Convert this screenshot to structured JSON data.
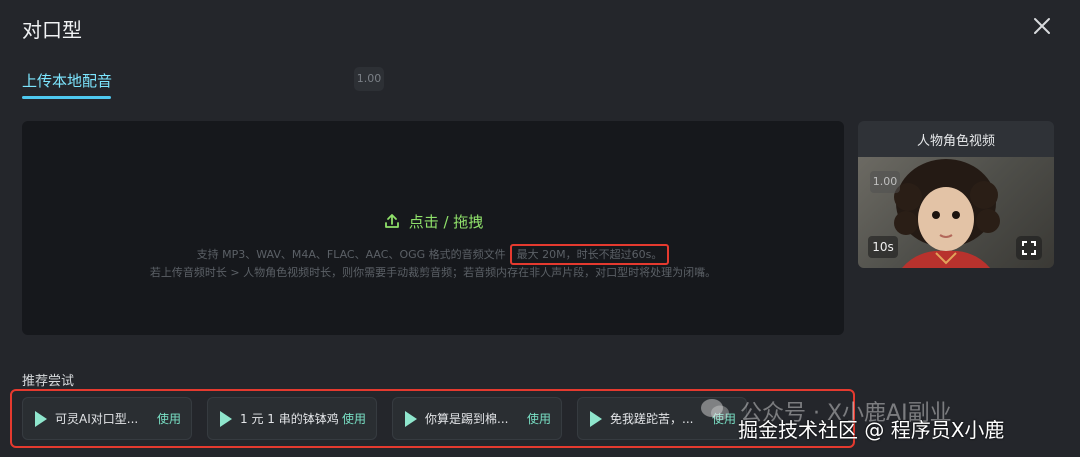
{
  "dialog": {
    "title": "对口型"
  },
  "tabs": [
    {
      "label": "上传本地配音"
    }
  ],
  "version_badge": "1.00",
  "upload": {
    "action_label": "点击 / 拖拽",
    "hint_line1_prefix": "支持 MP3、WAV、M4A、FLAC、AAC、OGG 格式的音频文件",
    "hint_line1_highlight": "最大 20M，时长不超过60s。",
    "hint_line2": "若上传音频时长 > 人物角色视频时长，则你需要手动裁剪音频；若音频内存在非人声片段，对口型时将处理为闭嘴。"
  },
  "video_card": {
    "title": "人物角色视频",
    "version": "1.00",
    "duration": "10s"
  },
  "recommend": {
    "label": "推荐尝试",
    "items": [
      {
        "text": "可灵AI对口型...",
        "use": "使用"
      },
      {
        "text": "1 元 1 串的钵钵鸡",
        "use": "使用"
      },
      {
        "text": "你算是踢到棉...",
        "use": "使用"
      },
      {
        "text": "免我蹉跎苦，...",
        "use": "使用"
      }
    ]
  },
  "watermarks": {
    "line1": "公众号 · X小鹿AI副业",
    "line2": "掘金技术社区 @ 程序员X小鹿"
  },
  "colors": {
    "accent_tab": "#4ec9f0",
    "upload_green": "#8fe06a",
    "highlight_red": "#e53a2f",
    "use_green": "#79e0c5"
  }
}
